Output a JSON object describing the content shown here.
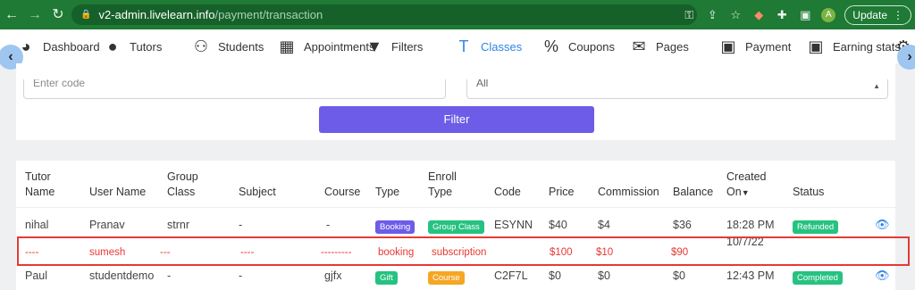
{
  "browser": {
    "url_host": "v2-admin.livelearn.info",
    "url_path": "/payment/transaction",
    "profile_initial": "A",
    "update_label": "Update"
  },
  "nav": {
    "items": [
      {
        "label": "Dashboard",
        "icon": "palette-icon"
      },
      {
        "label": "Tutors",
        "icon": "user-icon"
      },
      {
        "label": "Students",
        "icon": "users-icon"
      },
      {
        "label": "Appointments",
        "icon": "calendar-icon"
      },
      {
        "label": "Filters",
        "icon": "filter-icon"
      },
      {
        "label": "Classes",
        "icon": "text-icon",
        "active": true
      },
      {
        "label": "Coupons",
        "icon": "percent-icon"
      },
      {
        "label": "Pages",
        "icon": "envelope-icon"
      },
      {
        "label": "Payment",
        "icon": "money-icon"
      },
      {
        "label": "Earning stats",
        "icon": "money-icon"
      }
    ]
  },
  "filter": {
    "code_placeholder": "Enter code",
    "select_value": "All",
    "button_label": "Filter"
  },
  "table": {
    "headers": {
      "tutor_name": [
        "Tutor",
        "Name"
      ],
      "user_name": "User Name",
      "group_class": [
        "Group",
        "Class"
      ],
      "subject": "Subject",
      "course": "Course",
      "type": "Type",
      "enroll_type": [
        "Enroll",
        "Type"
      ],
      "code": "Code",
      "price": "Price",
      "commission": "Commission",
      "balance": "Balance",
      "created_on": [
        "Created",
        "On"
      ],
      "status": "Status"
    },
    "rows": [
      {
        "tutor": "nihal",
        "user": "Pranav",
        "group_class": "strnr",
        "subject": "-",
        "course": "-",
        "type": "Booking",
        "enroll_type": "Group Class",
        "code": "ESYNN",
        "price": "$40",
        "commission": "$4",
        "balance": "$36",
        "created_time": "18:28 PM",
        "created_date": "10/7/22",
        "status": "Refunded"
      },
      {
        "tutor": "Paul",
        "user": "studentdemo",
        "group_class": "-",
        "subject": "-",
        "course": "gjfx",
        "type": "Gift",
        "enroll_type": "Course",
        "code": "C2F7L",
        "price": "$0",
        "commission": "$0",
        "balance": "$0",
        "created_time": "12:43 PM",
        "status": "Completed"
      }
    ],
    "highlight_row": {
      "tutor": "----",
      "user": "sumesh",
      "group_class": "---",
      "subject": "----",
      "course": "---------",
      "type": "booking",
      "enroll_type": "subscription",
      "price": "$100",
      "commission": "$10",
      "balance": "$90"
    }
  },
  "colors": {
    "accent": "#2e86e6",
    "filter_button": "#6c5ce7",
    "badge_booking": "#6c5ce7",
    "badge_group_class": "#26c281",
    "badge_gift": "#26c281",
    "badge_course": "#f5a623",
    "badge_refunded": "#26c281",
    "badge_completed": "#26c281",
    "highlight": "#e53935"
  }
}
